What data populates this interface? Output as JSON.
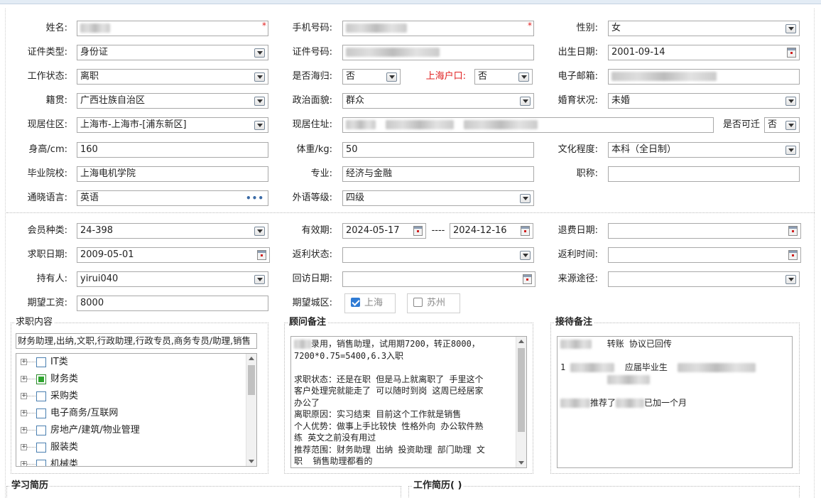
{
  "basic": {
    "name_label": "姓名:",
    "phone_label": "手机号码:",
    "gender_label": "性别:",
    "gender_value": "女",
    "idtype_label": "证件类型:",
    "idtype_value": "身份证",
    "idno_label": "证件号码:",
    "birth_label": "出生日期:",
    "birth_value": "2001-09-14",
    "workstatus_label": "工作状态:",
    "workstatus_value": "离职",
    "returnee_label": "是否海归:",
    "returnee_value": "否",
    "shhukou_label": "上海户口:",
    "shhukou_value": "否",
    "email_label": "电子邮箱:",
    "origin_label": "籍贯:",
    "origin_value": "广西壮族自治区",
    "politics_label": "政治面貌:",
    "politics_value": "群众",
    "marital_label": "婚育状况:",
    "marital_value": "未婚",
    "district_label": "现居住区:",
    "district_value": "上海市-上海市-[浦东新区]",
    "address_label": "现居住址:",
    "movable_label": "是否可迁",
    "movable_value": "否",
    "height_label": "身高/cm:",
    "height_value": "160",
    "weight_label": "体重/kg:",
    "weight_value": "50",
    "education_label": "文化程度:",
    "education_value": "本科（全日制）",
    "school_label": "毕业院校:",
    "school_value": "上海电机学院",
    "major_label": "专业:",
    "major_value": "经济与金融",
    "title_label": "职称:",
    "title_value": "",
    "language_label": "通晓语言:",
    "language_value": "英语",
    "langlevel_label": "外语等级:",
    "langlevel_value": "四级"
  },
  "member": {
    "type_label": "会员种类:",
    "type_value": "24-398",
    "valid_label": "有效期:",
    "valid_from": "2024-05-17",
    "valid_sep": "----",
    "valid_to": "2024-12-16",
    "refund_label": "退费日期:",
    "refund_value": "",
    "jobdate_label": "求职日期:",
    "jobdate_value": "2009-05-01",
    "rebate_status_label": "返利状态:",
    "rebate_status_value": "",
    "rebate_time_label": "返利时间:",
    "rebate_time_value": "",
    "holder_label": "持有人:",
    "holder_value": "yirui040",
    "visit_label": "回访日期:",
    "visit_value": "",
    "source_label": "来源途径:",
    "source_value": "",
    "salary_label": "期望工资:",
    "salary_value": "8000",
    "city_label": "期望城区:",
    "cities": [
      {
        "label": "上海",
        "checked": true
      },
      {
        "label": "苏州",
        "checked": false
      }
    ]
  },
  "job_content": {
    "title": "求职内容",
    "selected_text": "财务助理,出纳,文职,行政助理,行政专员,商务专员/助理,销售",
    "tree": [
      {
        "label": "IT类",
        "checked": false
      },
      {
        "label": "财务类",
        "checked": true
      },
      {
        "label": "采购类",
        "checked": false
      },
      {
        "label": "电子商务/互联网",
        "checked": false
      },
      {
        "label": "房地产/建筑/物业管理",
        "checked": false
      },
      {
        "label": "服装类",
        "checked": false
      },
      {
        "label": "机械类",
        "checked": false
      }
    ]
  },
  "consultant_note": {
    "title": "顾问备注",
    "lines": [
      "录用，销售助理，试用期7200，转正8000，",
      "7200*0.75=5400,6.3入职",
      "",
      "求职状态：还是在职 但是马上就离职了 手里这个",
      "客户处理完就能走了 可以随时到岗 这周已经居家",
      "办公了",
      "离职原因：实习结束 目前这个工作就是销售",
      "个人优势：做事上手比较快 性格外向 办公软件熟",
      "练 英文之前没有用过",
      "推荐范围：财务助理 出纳 投资助理 部门助理 文",
      "职  销售助理都看的"
    ]
  },
  "reception_note": {
    "title": "接待备注",
    "line1_text": "转账 协议已回传",
    "line2_prefix": "1",
    "line2_text": "应届毕业生",
    "line3_text_a": "推荐了",
    "line3_text_b": "已加一个月"
  },
  "sections": {
    "study": "学习简历",
    "work": "工作简历( )"
  }
}
